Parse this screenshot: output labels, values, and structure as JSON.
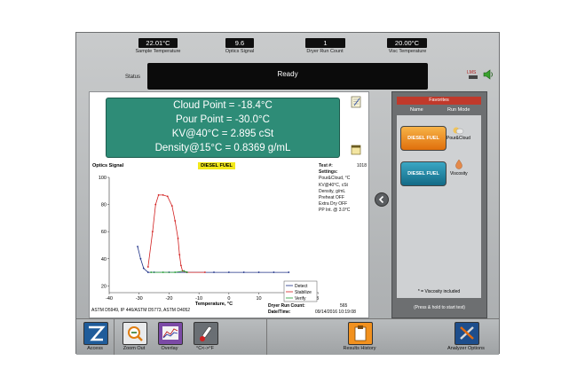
{
  "readouts": [
    {
      "value": "22.01°C",
      "label": "Sample Temperature"
    },
    {
      "value": "9.6",
      "label": "Optics Signal"
    },
    {
      "value": "1",
      "label": "Dryer Run Count"
    },
    {
      "value": "20.00°C",
      "label": "Visc Temperature"
    }
  ],
  "status": {
    "label": "Status",
    "value": "Ready"
  },
  "results": [
    "Cloud Point = -18.4°C",
    "Pour Point = -30.0°C",
    "KV@40°C = 2.895 cSt",
    "Density@15°C = 0.8369 g/mL"
  ],
  "plot_header": {
    "optics_label": "Optics Signal",
    "fuel_badge": "DIESEL FUEL"
  },
  "test_info": {
    "test_label": "Test #:",
    "test_value": "1018",
    "settings_label": "Settings:",
    "settings": [
      "Pour&Cloud, °C",
      "KV@40°C, cSt",
      "Density, g/mL",
      "Preheat OFF",
      "Extra Dry OFF",
      "PP Int. @ 3.0°C"
    ]
  },
  "legend": [
    "Detect",
    "Stabilize",
    "Verify"
  ],
  "footer": {
    "standards": "ASTM D5949, IP 446/ASTM D5773, ASTM D4052",
    "dryer_label": "Dryer Run Count:",
    "dryer_value": "565",
    "date_label": "Date/Time:",
    "date_value": "09/14/2016 10:19:08"
  },
  "favorites": {
    "title": "Favorites",
    "col_name": "Name",
    "col_mode": "Run Mode",
    "items": [
      {
        "name": "DIESEL FUEL",
        "mode": "Pour&Cloud"
      },
      {
        "name": "DIESEL FUEL",
        "mode": "Viscosity"
      }
    ],
    "note": "* = Viscosity included",
    "hint": "(Press & hold to start test)"
  },
  "toolbar": {
    "access": "Access",
    "zoom_out": "Zoom Out",
    "overlay": "Overlay",
    "unit_toggle": "°C<->°F",
    "results_history": "Results History",
    "analyzer_options": "Analyzer Options"
  },
  "header_icon": {
    "text": "LMS"
  },
  "colors": {
    "result_box": "#2e8c77",
    "detect": "#1c2f86",
    "stabilize": "#d21f1f",
    "verify": "#1e9b2e",
    "diesel_orange": "#f08a1b",
    "diesel_blue": "#1a7f9e"
  },
  "chart_data": {
    "type": "line",
    "title": "DIESEL FUEL",
    "ylabel": "Optics Signal",
    "xlabel": "Temperature, °C",
    "xlim": [
      -40,
      30
    ],
    "ylim": [
      15,
      100
    ],
    "xticks": [
      -40,
      -30,
      -20,
      -10,
      0,
      10,
      20,
      30
    ],
    "yticks": [
      20,
      40,
      60,
      80,
      100
    ],
    "grid": false,
    "legend_position": "bottom-right",
    "series": [
      {
        "name": "Detect",
        "points": [
          [
            -30.5,
            49
          ],
          [
            -29.5,
            40
          ],
          [
            -28.5,
            33
          ],
          [
            -27,
            30
          ],
          [
            -25,
            30
          ],
          [
            -20,
            30
          ],
          [
            -14,
            30
          ],
          [
            -5,
            30
          ],
          [
            0,
            30
          ],
          [
            5,
            30
          ],
          [
            10,
            30
          ],
          [
            15,
            30
          ],
          [
            20,
            30
          ]
        ]
      },
      {
        "name": "Stabilize",
        "points": [
          [
            -27,
            34
          ],
          [
            -25.5,
            60
          ],
          [
            -24.5,
            80
          ],
          [
            -23.5,
            87
          ],
          [
            -22,
            87
          ],
          [
            -20.5,
            86
          ],
          [
            -19,
            79
          ],
          [
            -18,
            68
          ],
          [
            -17,
            55
          ],
          [
            -16.5,
            43
          ],
          [
            -16,
            35
          ],
          [
            -15.5,
            31
          ],
          [
            -14,
            30
          ],
          [
            -8,
            30
          ]
        ]
      },
      {
        "name": "Verify",
        "points": [
          [
            -26,
            30
          ],
          [
            -22,
            30
          ],
          [
            -18,
            30
          ],
          [
            -15,
            31
          ],
          [
            -14,
            30
          ]
        ]
      }
    ]
  }
}
